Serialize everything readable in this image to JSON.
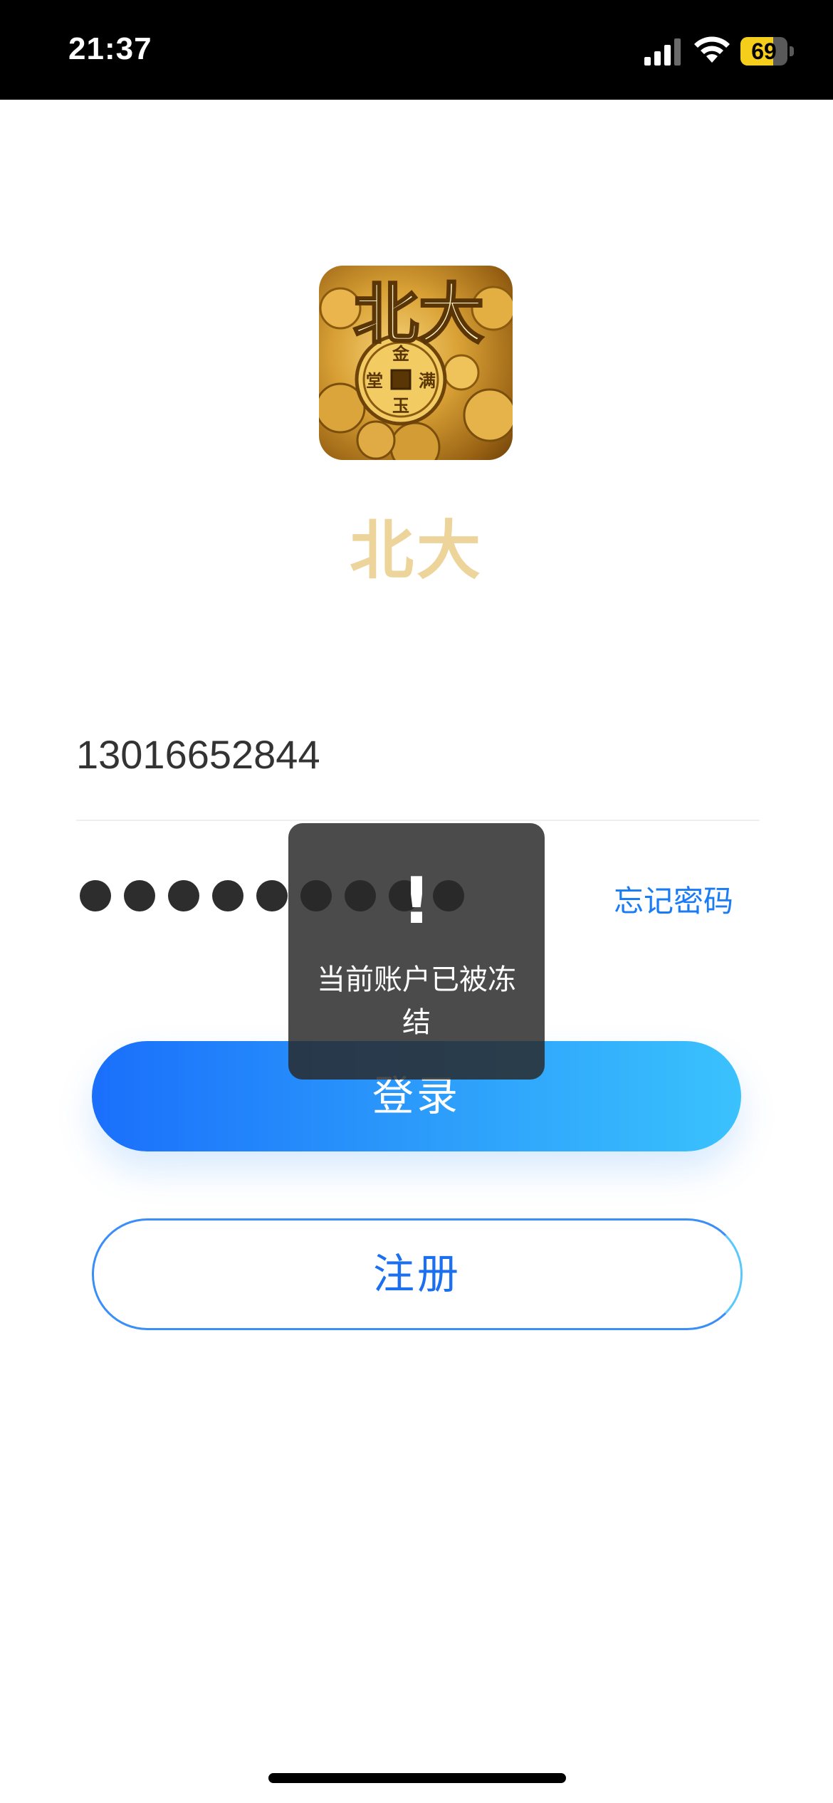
{
  "status_bar": {
    "time": "21:37",
    "battery_level": "69",
    "battery_fraction": 0.69,
    "icons": [
      "signal-icon",
      "wifi-icon",
      "battery-icon"
    ]
  },
  "app": {
    "logo": {
      "icon": "app-logo",
      "glyph_text": "北大",
      "coin_text": [
        "金",
        "满",
        "玉",
        "堂"
      ]
    },
    "name": "北大"
  },
  "login_form": {
    "phone_value": "13016652844",
    "password_mask_count": 9,
    "forgot_password_label": "忘记密码",
    "login_button_label": "登录",
    "register_button_label": "注册"
  },
  "toast": {
    "icon": "exclamation-icon",
    "icon_glyph": "!",
    "message": "当前账户已被冻结"
  },
  "colors": {
    "accent_blue": "#1a7cf5",
    "gradient_start": "#1a6ffb",
    "gradient_end": "#3ac2fd",
    "app_name_gold": "#ecd49a",
    "battery_yellow": "#f5cd1b"
  }
}
